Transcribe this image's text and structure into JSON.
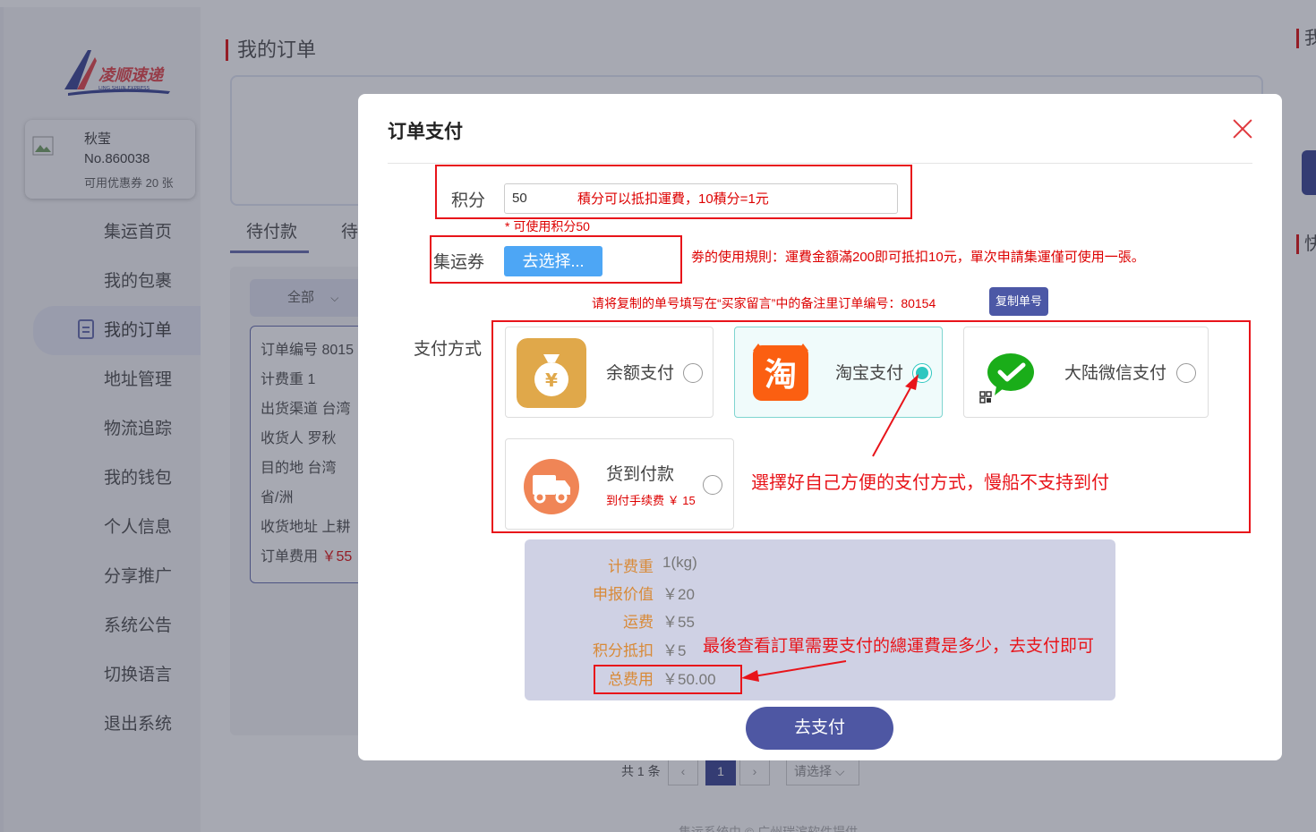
{
  "sidebar": {
    "logo_text": "凌顺速递",
    "logo_subtext": "LING SHUN EXPRESS",
    "user": {
      "name": "秋莹",
      "number": "No.860038",
      "coupon": "可用优惠券 20 张"
    },
    "items": [
      {
        "label": "集运首页"
      },
      {
        "label": "我的包裹"
      },
      {
        "label": "我的订单"
      },
      {
        "label": "地址管理"
      },
      {
        "label": "物流追踪"
      },
      {
        "label": "我的钱包"
      },
      {
        "label": "个人信息"
      },
      {
        "label": "分享推广"
      },
      {
        "label": "系统公告"
      },
      {
        "label": "切换语言"
      },
      {
        "label": "退出系统"
      }
    ]
  },
  "main": {
    "title": "我的订单",
    "tabs": [
      {
        "label": "待付款"
      },
      {
        "label": "待"
      }
    ],
    "filter": {
      "label": "全部"
    },
    "order": {
      "lines": [
        {
          "label": "订单编号 8015"
        },
        {
          "label": "计费重 1"
        },
        {
          "label": "出货渠道 台湾"
        },
        {
          "label": "收货人 罗秋"
        },
        {
          "label": "目的地 台湾"
        },
        {
          "label": "省/洲"
        },
        {
          "label": "收货地址 上耕"
        }
      ],
      "fee_label": "订单费用",
      "fee_value": "￥55"
    },
    "pagination": {
      "total_text": "共 1 条",
      "prev": "‹",
      "current": "1",
      "next": "›",
      "size_placeholder": "请选择"
    },
    "footer": "集运系统由 © 广州瑞滨软件提供"
  },
  "right_strip": {
    "label1": "我",
    "label2": "快"
  },
  "modal": {
    "title": "订单支付",
    "points": {
      "label": "积分",
      "value": "50",
      "tip": "積分可以抵扣運費，10積分=1元",
      "available": "* 可使用积分50"
    },
    "coupon": {
      "label": "集运券",
      "button": "去选择...",
      "rule": "劵的使用規則：運費金額滿200即可抵扣10元，單次申請集運僅可使用一張。"
    },
    "copy": {
      "tip": "请将复制的单号填写在“买家留言”中的备注里订单编号：80154",
      "button": "复制单号"
    },
    "payment": {
      "label": "支付方式",
      "methods": [
        {
          "name": "余额支付",
          "icon": "money-bag-icon",
          "selected": false
        },
        {
          "name": "淘宝支付",
          "icon": "taobao-icon",
          "glyph": "淘",
          "selected": true
        },
        {
          "name": "大陆微信支付",
          "icon": "wechat-icon",
          "selected": false
        },
        {
          "name": "货到付款",
          "sub": "到付手续费 ￥ 15",
          "icon": "delivery-truck-icon",
          "selected": false
        }
      ],
      "annotation": "選擇好自己方便的支付方式，慢船不支持到付"
    },
    "summary": {
      "rows": [
        {
          "key": "计费重",
          "value": "1(kg)"
        },
        {
          "key": "申报价值",
          "value": "￥20"
        },
        {
          "key": "运费",
          "value": "￥55"
        },
        {
          "key": "积分抵扣",
          "value": "￥5"
        },
        {
          "key": "总费用",
          "value": "￥50.00"
        }
      ],
      "annotation": "最後查看訂單需要支付的總運費是多少，去支付即可"
    },
    "pay_button": "去支付"
  },
  "colors": {
    "accent": "#4e57a3",
    "annotation_red": "#e8141a",
    "selected_teal": "#2ec7c0",
    "fee_orange": "#d88a38"
  }
}
